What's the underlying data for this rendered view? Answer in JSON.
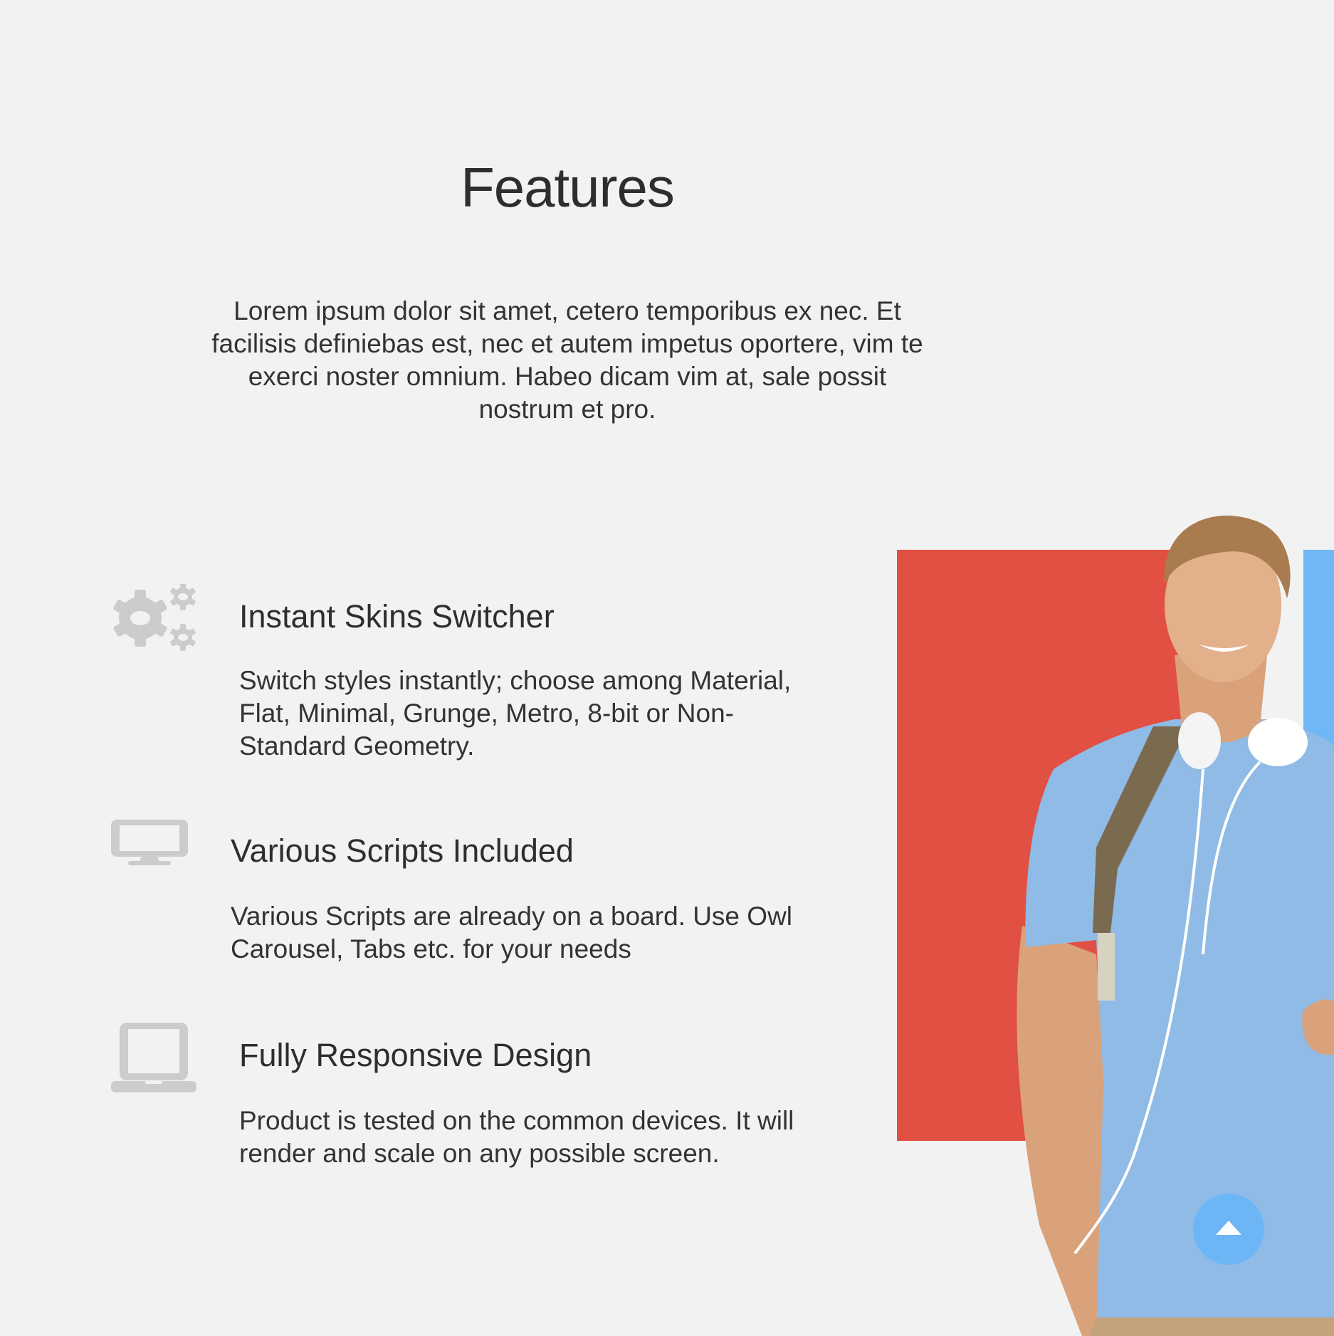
{
  "section": {
    "title": "Features",
    "intro": "Lorem ipsum dolor sit amet, cetero temporibus ex nec. Et facilisis definiebas est, nec et autem impetus oportere, vim te exerci noster omnium. Habeo dicam vim at, sale possit nostrum et pro."
  },
  "features": [
    {
      "icon": "gears-icon",
      "title": "Instant Skins Switcher",
      "description": "Switch styles instantly; choose among Material, Flat, Minimal, Grunge, Metro, 8-bit or Non-Standard Geometry."
    },
    {
      "icon": "desktop-icon",
      "title": "Various Scripts Included",
      "description": "Various Scripts are already on a board. Use Owl Carousel, Tabs etc. for your needs"
    },
    {
      "icon": "laptop-icon",
      "title": "Fully Responsive Design",
      "description": "Product is tested on the common devices. It will render and scale on any possible screen."
    }
  ],
  "colors": {
    "accent_red": "#e15043",
    "accent_blue": "#6fb7f5",
    "icon_gray": "#cccccc",
    "background": "#f2f2f2"
  },
  "scroll_top": {
    "icon": "arrow-up-icon"
  }
}
